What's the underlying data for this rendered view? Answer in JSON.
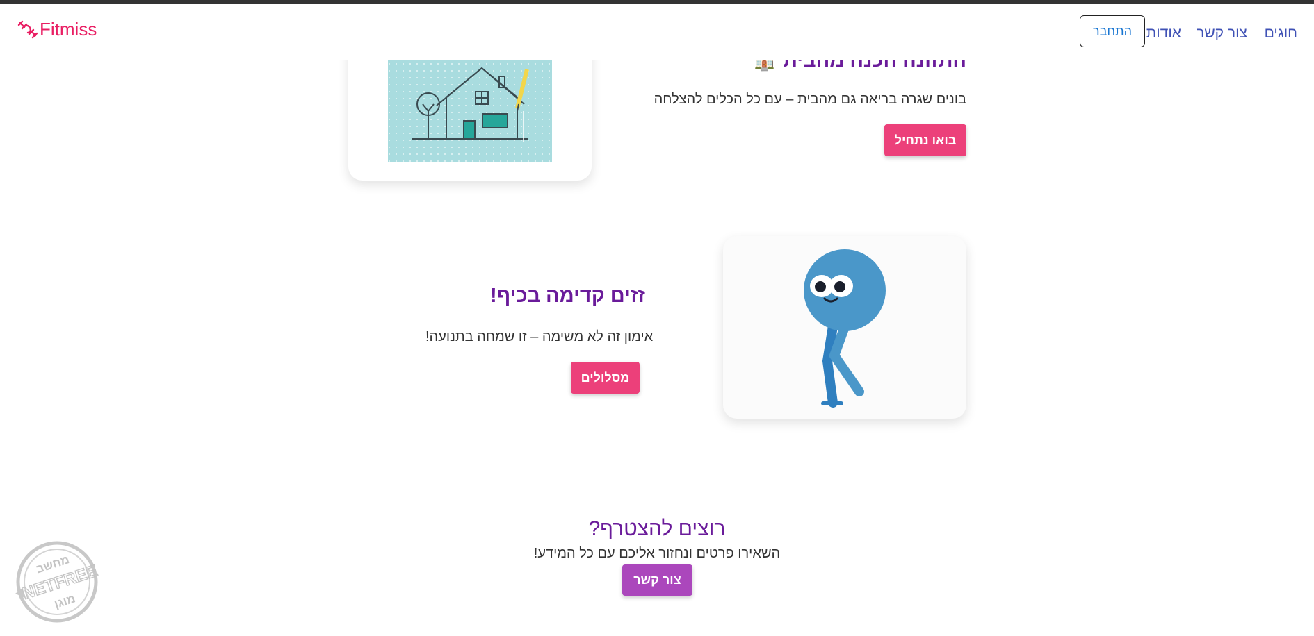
{
  "navbar": {
    "brand": "Fitmiss",
    "links": {
      "chugim": "חוגים",
      "contact": "צור קשר",
      "about": "אודות"
    },
    "login_label": "התחבר"
  },
  "section_home": {
    "title": "התזונה הכנה מהבית 🏠",
    "text": "בונים שגרה בריאה גם מהבית – עם כל הכלים להצלחה",
    "button": "בואו נתחיל"
  },
  "section_walk": {
    "title": "זזים קדימה בכיף!",
    "text": "אימון זה לא משימה – זו שמחה בתנועה!",
    "button": "מסלולים"
  },
  "join": {
    "title": "רוצים להצטרף?",
    "subtitle": "השאירו פרטים ונחזור אליכם עם כל המידע!",
    "button": "צור קשר"
  },
  "badge": {
    "line1": "מחשב",
    "line2": "NETFREE",
    "line3": "מוגן"
  },
  "colors": {
    "brand": "#e91e63",
    "nav_link": "#3f51b5",
    "heading": "#6a1b9a",
    "primary_button": "#ec407a",
    "contact_button": "#ab47bc"
  }
}
